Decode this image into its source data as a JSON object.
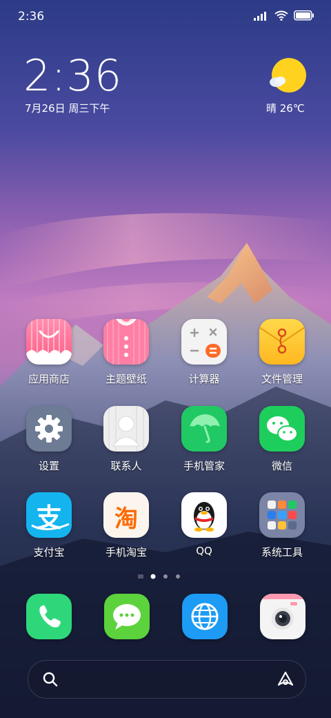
{
  "status_bar": {
    "time": "2:36"
  },
  "clock": {
    "time": "2:36",
    "date": "7月26日 周三下午"
  },
  "weather": {
    "text": "晴 26℃"
  },
  "apps": [
    {
      "label": "应用商店"
    },
    {
      "label": "主题壁纸"
    },
    {
      "label": "计算器"
    },
    {
      "label": "文件管理"
    },
    {
      "label": "设置"
    },
    {
      "label": "联系人"
    },
    {
      "label": "手机管家"
    },
    {
      "label": "微信"
    },
    {
      "label": "支付宝"
    },
    {
      "label": "手机淘宝"
    },
    {
      "label": "QQ"
    },
    {
      "label": "系统工具"
    }
  ],
  "icon_text": {
    "alipay": "支",
    "taobao": "淘"
  },
  "colors": {
    "accent_green": "#3fd36a",
    "weather_sun": "#ffd21f"
  }
}
